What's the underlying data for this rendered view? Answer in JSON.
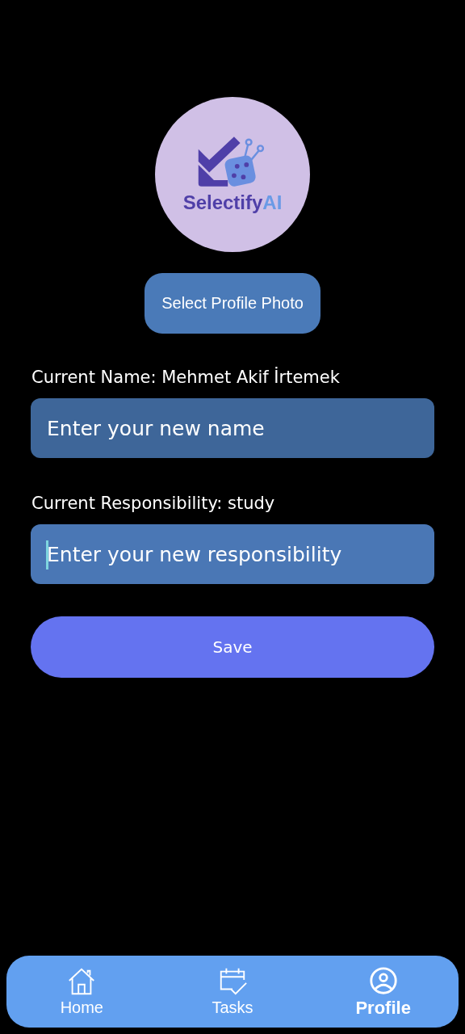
{
  "logo": {
    "wordmark": "Selectify",
    "wordmark_accent": "AI"
  },
  "photo_button": {
    "label": "Select Profile Photo"
  },
  "fields": [
    {
      "label": "Current Name: Mehmet Akif İrtemek",
      "placeholder": "Enter your new name",
      "focused": false
    },
    {
      "label": "Current Responsibility: study",
      "placeholder": "Enter your new responsibility",
      "focused": true
    }
  ],
  "save_button": {
    "label": "Save"
  },
  "nav": [
    {
      "kind": "home",
      "label": "Home",
      "selected": false
    },
    {
      "kind": "tasks",
      "label": "Tasks",
      "selected": false
    },
    {
      "kind": "profile",
      "label": "Profile",
      "selected": true
    }
  ]
}
